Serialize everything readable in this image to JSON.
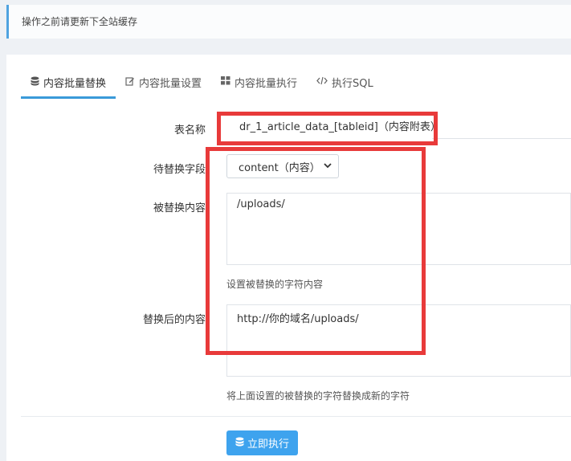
{
  "notice": {
    "text": "操作之前请更新下全站缓存"
  },
  "tabs": [
    {
      "label": "内容批量替换",
      "icon": "database-icon"
    },
    {
      "label": "内容批量设置",
      "icon": "edit-icon"
    },
    {
      "label": "内容批量执行",
      "icon": "grid-icon"
    },
    {
      "label": "执行SQL",
      "icon": "code-icon"
    }
  ],
  "form": {
    "table": {
      "label": "表名称",
      "value": "dr_1_article_data_[tableid]（内容附表）"
    },
    "field": {
      "label": "待替换字段",
      "value": "content（内容）"
    },
    "search": {
      "label": "被替换内容",
      "value": "/uploads/",
      "help": "设置被替换的字符内容"
    },
    "replace": {
      "label": "替换后的内容",
      "value": "http://你的域名/uploads/",
      "help": "将上面设置的被替换的字符替换成新的字符"
    }
  },
  "submit": {
    "label": "立即执行"
  },
  "colors": {
    "accent": "#3ea3ee",
    "highlight": "#e83a3a"
  }
}
